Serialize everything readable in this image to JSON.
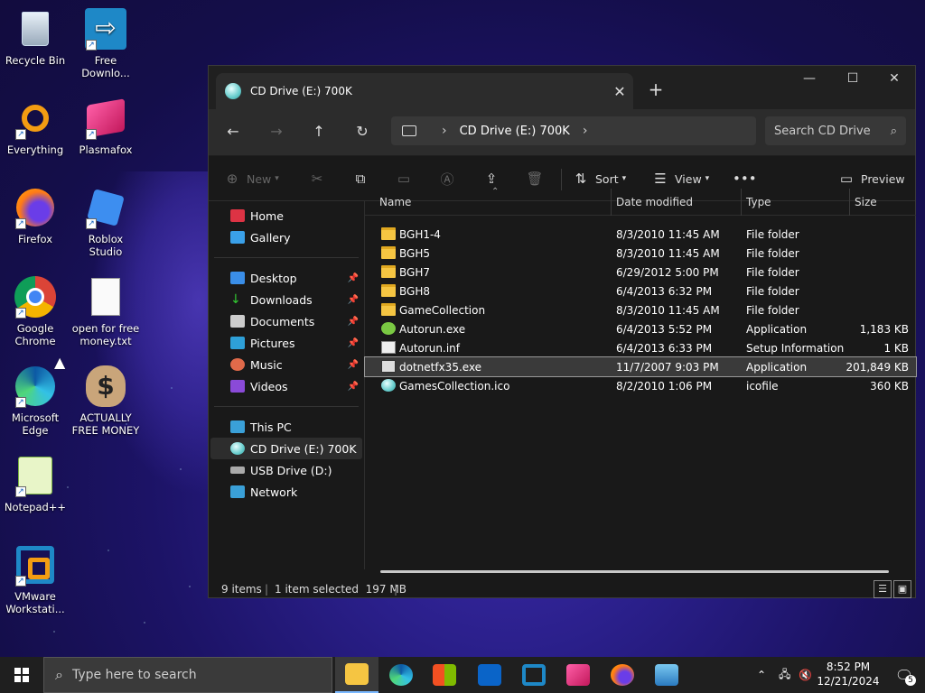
{
  "desktop": {
    "icons": [
      {
        "label": "Recycle Bin"
      },
      {
        "label": "Free Downlo..."
      },
      {
        "label": "Everything"
      },
      {
        "label": "Plasmafox"
      },
      {
        "label": "Firefox"
      },
      {
        "label": "Roblox Studio"
      },
      {
        "label": "Google Chrome"
      },
      {
        "label": "open for free money.txt"
      },
      {
        "label": "Microsoft Edge"
      },
      {
        "label": "ACTUALLY FREE MONEY"
      },
      {
        "label": "Notepad++"
      },
      {
        "label": "VMware Workstati..."
      }
    ]
  },
  "explorer": {
    "tab_title": "CD Drive (E:) 700K",
    "breadcrumb": "CD Drive (E:) 700K",
    "search_placeholder": "Search CD Drive",
    "toolbar": {
      "new_label": "New",
      "sort_label": "Sort",
      "view_label": "View",
      "preview_label": "Preview"
    },
    "nav": {
      "quick": [
        {
          "label": "Home"
        },
        {
          "label": "Gallery"
        }
      ],
      "pinned": [
        {
          "label": "Desktop"
        },
        {
          "label": "Downloads"
        },
        {
          "label": "Documents"
        },
        {
          "label": "Pictures"
        },
        {
          "label": "Music"
        },
        {
          "label": "Videos"
        }
      ],
      "devices": [
        {
          "label": "This PC"
        },
        {
          "label": "CD Drive (E:) 700K"
        },
        {
          "label": "USB Drive (D:)"
        },
        {
          "label": "Network"
        }
      ]
    },
    "columns": {
      "name": "Name",
      "date": "Date modified",
      "type": "Type",
      "size": "Size"
    },
    "files": [
      {
        "name": "BGH1-4",
        "date": "8/3/2010 11:45 AM",
        "type": "File folder",
        "size": ""
      },
      {
        "name": "BGH5",
        "date": "8/3/2010 11:45 AM",
        "type": "File folder",
        "size": ""
      },
      {
        "name": "BGH7",
        "date": "6/29/2012 5:00 PM",
        "type": "File folder",
        "size": ""
      },
      {
        "name": "BGH8",
        "date": "6/4/2013 6:32 PM",
        "type": "File folder",
        "size": ""
      },
      {
        "name": "GameCollection",
        "date": "8/3/2010 11:45 AM",
        "type": "File folder",
        "size": ""
      },
      {
        "name": "Autorun.exe",
        "date": "6/4/2013 5:52 PM",
        "type": "Application",
        "size": "1,183 KB"
      },
      {
        "name": "Autorun.inf",
        "date": "6/4/2013 6:33 PM",
        "type": "Setup Information",
        "size": "1 KB"
      },
      {
        "name": "dotnetfx35.exe",
        "date": "11/7/2007 9:03 PM",
        "type": "Application",
        "size": "201,849 KB"
      },
      {
        "name": "GamesCollection.ico",
        "date": "8/2/2010 1:06 PM",
        "type": "icofile",
        "size": "360 KB"
      }
    ],
    "status": {
      "items": "9 items",
      "selected": "1 item selected  197 MB"
    }
  },
  "taskbar": {
    "search_placeholder": "Type here to search",
    "time": "8:52 PM",
    "date": "12/21/2024",
    "notification_count": "5"
  }
}
